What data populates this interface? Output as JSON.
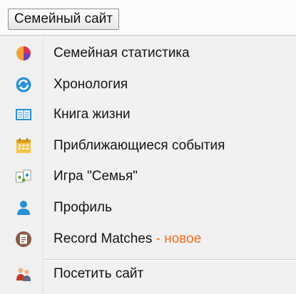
{
  "menu_button": {
    "label": "Семейный сайт"
  },
  "items": [
    {
      "label": "Семейная статистика",
      "icon": "pie-chart-icon"
    },
    {
      "label": "Хронология",
      "icon": "timeline-arrows-icon"
    },
    {
      "label": "Книга жизни",
      "icon": "open-book-icon"
    },
    {
      "label": "Приближающиеся события",
      "icon": "calendar-icon"
    },
    {
      "label": "Игра \"Семья\"",
      "icon": "game-cards-icon"
    },
    {
      "label": "Профиль",
      "icon": "person-icon"
    },
    {
      "label": "Record Matches",
      "suffix": " - новое",
      "icon": "record-matches-icon"
    },
    {
      "label": "Посетить сайт",
      "icon": "family-people-icon"
    }
  ],
  "colors": {
    "new_tag": "#f26e21",
    "accent_blue": "#2a8fd6"
  }
}
